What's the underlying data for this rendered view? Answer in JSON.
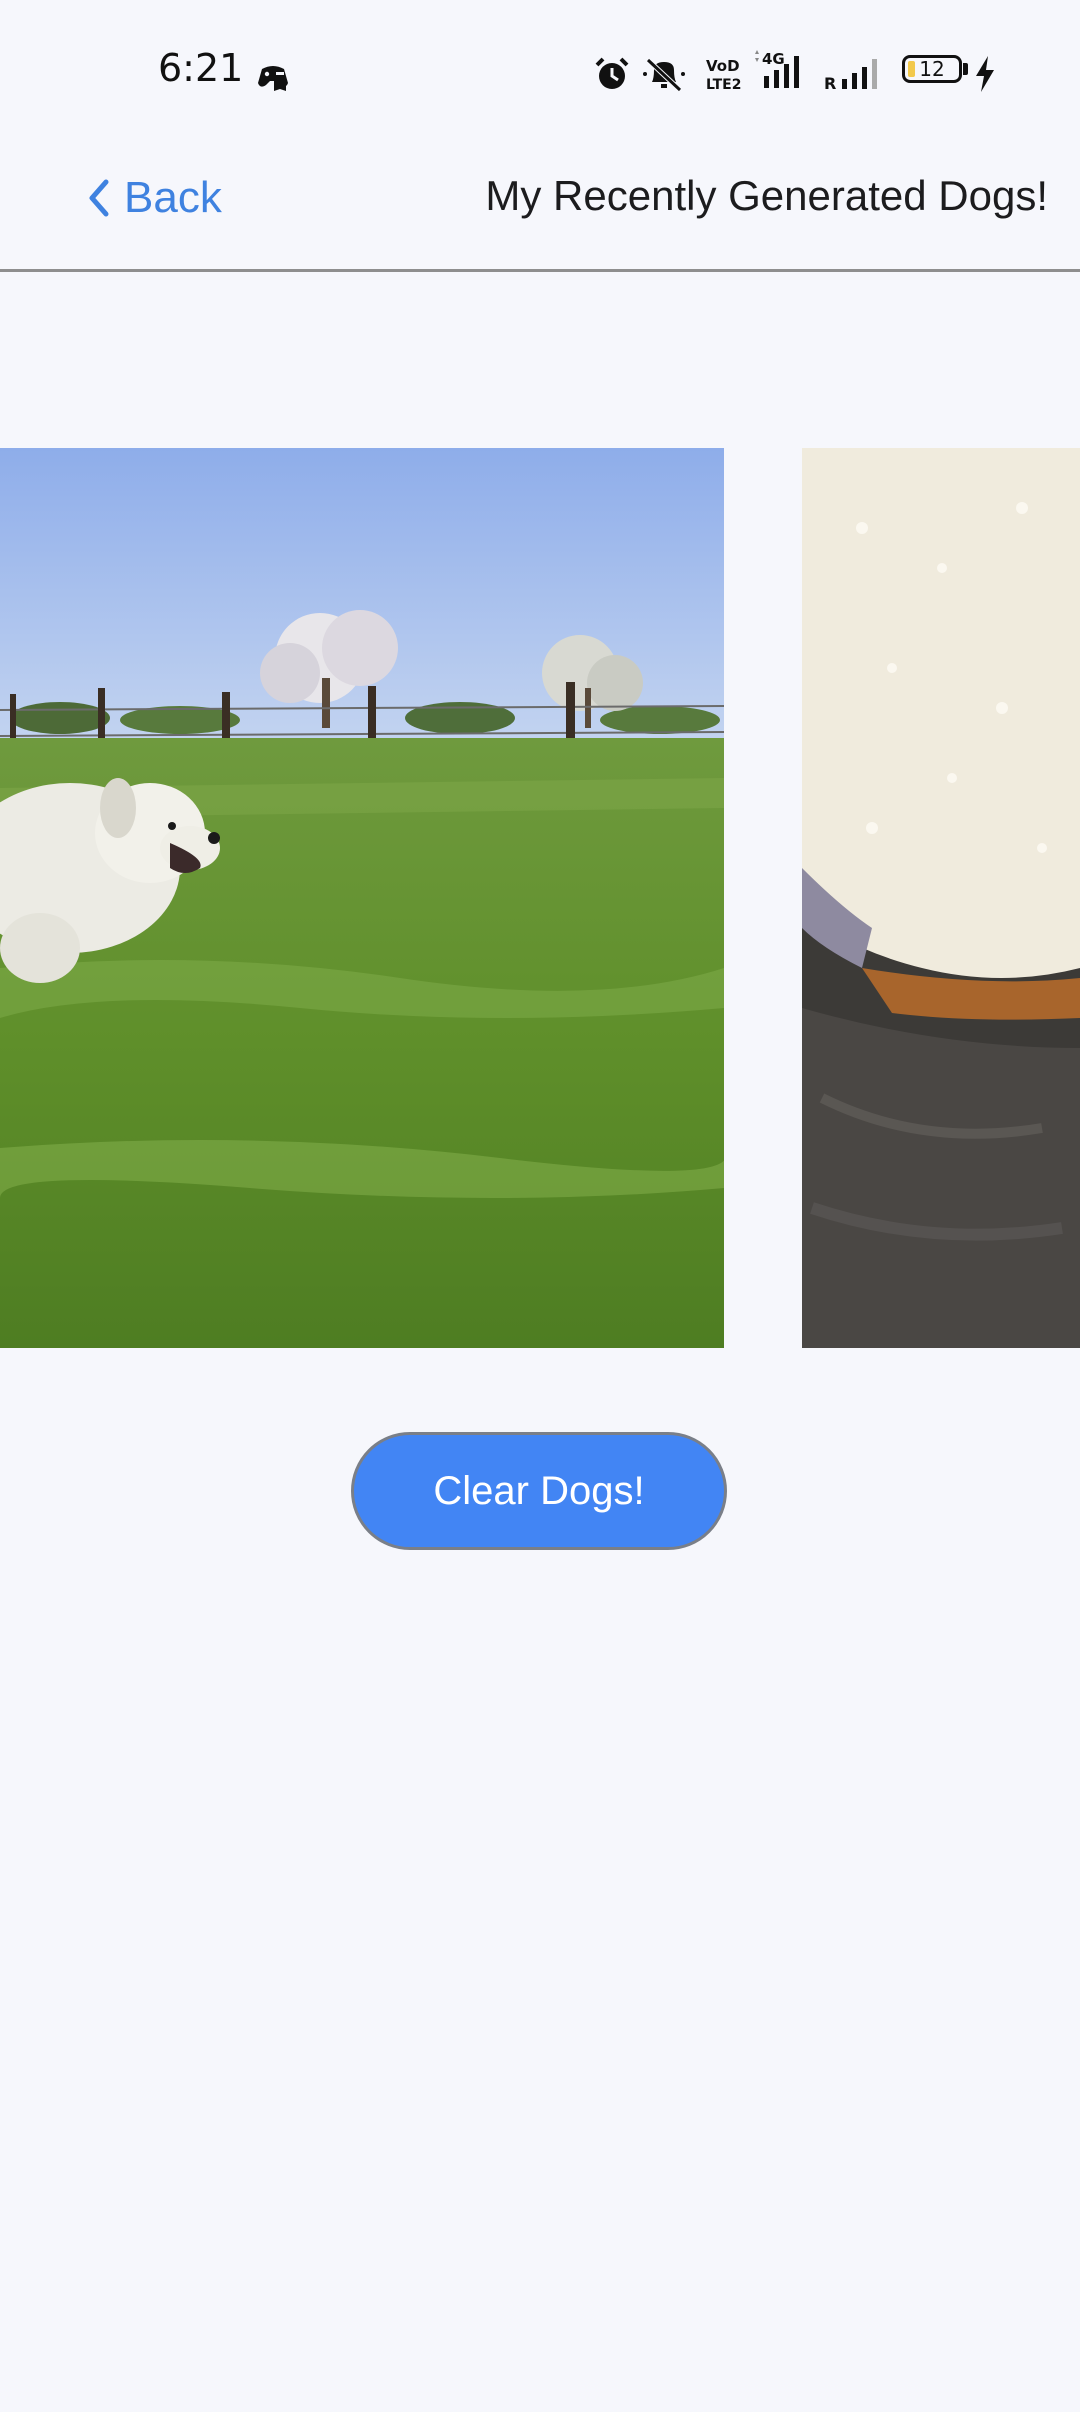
{
  "status_bar": {
    "time": "6:21",
    "battery_level": "12",
    "icons": [
      "game-controller-icon",
      "alarm-icon",
      "muted-bell-icon",
      "volte-icon",
      "signal-4g-icon",
      "signal-roaming-icon",
      "battery-icon",
      "charging-bolt-icon"
    ]
  },
  "header": {
    "back_label": "Back",
    "title": "My Recently Generated Dogs!",
    "accent_color": "#3f82e0"
  },
  "carousel": {
    "items": [
      {
        "image": "great-pyrenees-in-grass-field"
      },
      {
        "image": "white-and-gray-fur-closeup"
      }
    ]
  },
  "actions": {
    "clear_label": "Clear Dogs!",
    "button_color": "#4285f4"
  }
}
